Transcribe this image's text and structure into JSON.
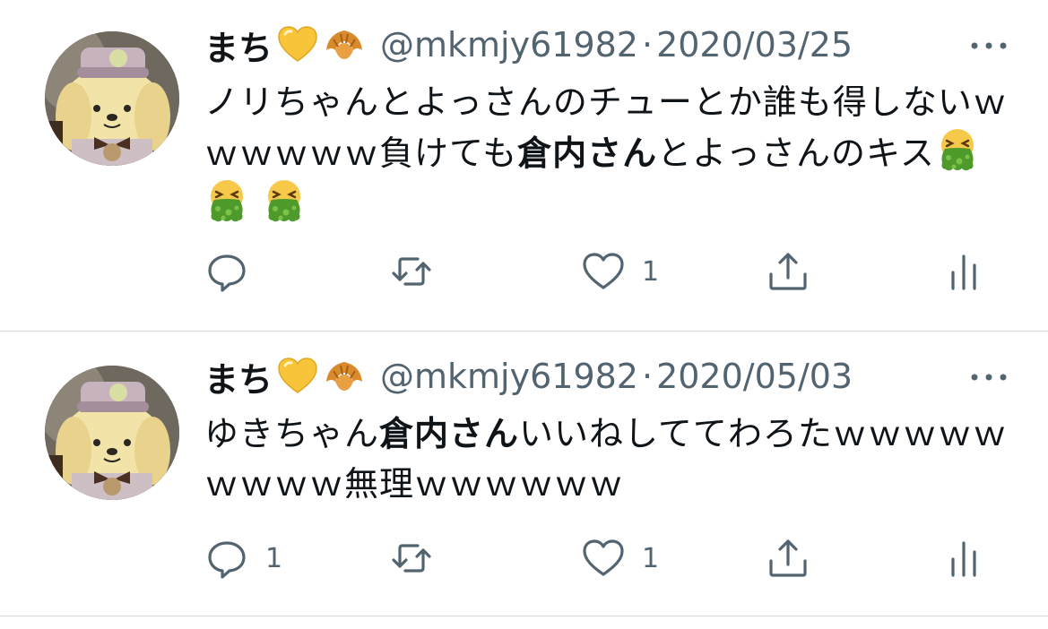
{
  "tweets": [
    {
      "name": "まち",
      "name_emojis": [
        "yellow-heart-icon",
        "croissant-icon"
      ],
      "handle": "@mkmjy61982",
      "separator": "·",
      "date": "2020/03/25",
      "text_parts": [
        "ノリちゃんとよっさんのチューとか誰も得しないｗｗｗｗｗｗ負けても",
        "倉内さん",
        "とよっさんのキス"
      ],
      "trailing_emojis": [
        "vomiting-face-icon",
        "vomiting-face-icon",
        "vomiting-face-icon"
      ],
      "reply_count": "",
      "retweet_count": "",
      "like_count": "1"
    },
    {
      "name": "まち",
      "name_emojis": [
        "yellow-heart-icon",
        "croissant-icon"
      ],
      "handle": "@mkmjy61982",
      "separator": "·",
      "date": "2020/05/03",
      "text_parts": [
        "ゆきちゃん",
        "倉内さん",
        "いいねしててわろたｗｗｗｗｗｗｗｗｗ無理ｗｗｗｗｗｗ"
      ],
      "trailing_emojis": [],
      "reply_count": "1",
      "retweet_count": "",
      "like_count": "1"
    }
  ],
  "colors": {
    "text": "#0f1419",
    "secondary": "#536471",
    "divider": "#d5d9dc",
    "heart_yellow": "#f7c43a",
    "croissant": "#d98a2b",
    "vomit_green": "#4e9a2a"
  }
}
